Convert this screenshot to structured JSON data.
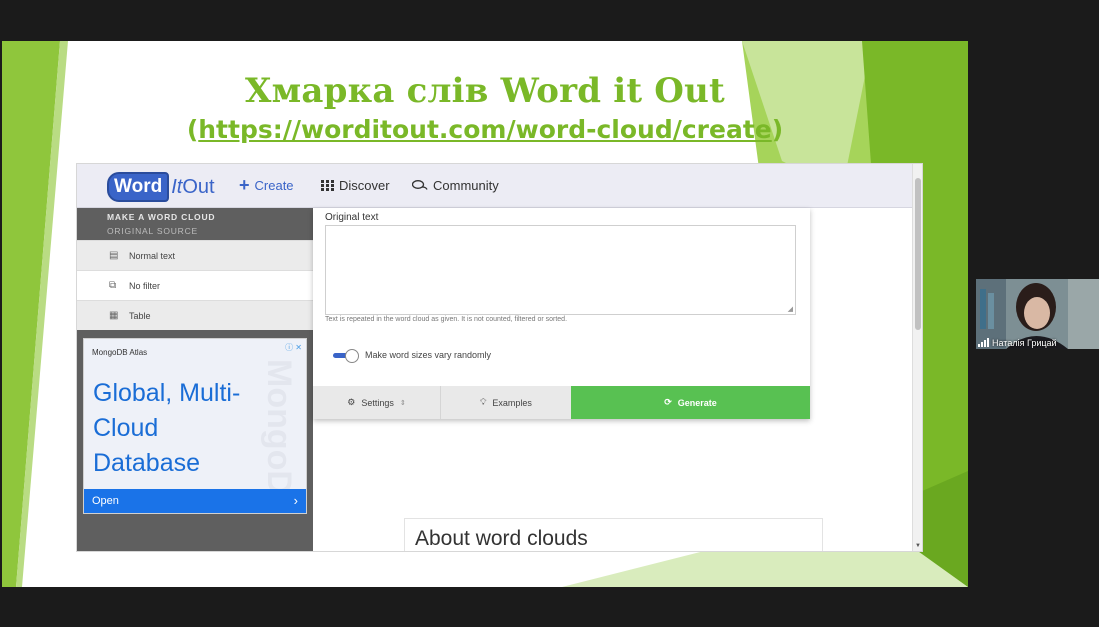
{
  "slide": {
    "title": "Хмарка слів Word it Out",
    "url_open": "(",
    "url": "https://worditout.com/word-cloud/create",
    "url_close": ")"
  },
  "site": {
    "logo": {
      "word": "Word",
      "it": "It",
      "out": "Out"
    },
    "nav": {
      "create": "Create",
      "discover": "Discover",
      "community": "Community"
    },
    "sidebar": {
      "heading": "MAKE A WORD CLOUD",
      "subheading": "ORIGINAL SOURCE",
      "items": [
        {
          "label": "Normal text",
          "icon": "document-icon"
        },
        {
          "label": "No filter",
          "icon": "copy-icon"
        },
        {
          "label": "Table",
          "icon": "table-icon"
        }
      ]
    },
    "ad": {
      "brand": "MongoDB Atlas",
      "headline_1": "Global, Multi-",
      "headline_2": "Cloud",
      "headline_3": "Database",
      "watermark": "MongoDB",
      "cta": "Open"
    },
    "form": {
      "original_text_label": "Original text",
      "original_text_value": "",
      "hint": "Text is repeated in the word cloud as given. It is not counted, filtered or sorted.",
      "toggle_label": "Make word sizes vary randomly",
      "toggle_on": true,
      "settings_label": "Settings",
      "examples_label": "Examples",
      "generate_label": "Generate"
    },
    "about_heading": "About word clouds"
  },
  "participant": {
    "name": "Наталія Грицай"
  },
  "colors": {
    "slide_green": "#7ab828",
    "brand_blue": "#3a64c8",
    "generate_green": "#58c152",
    "ad_blue": "#1a73e8"
  }
}
